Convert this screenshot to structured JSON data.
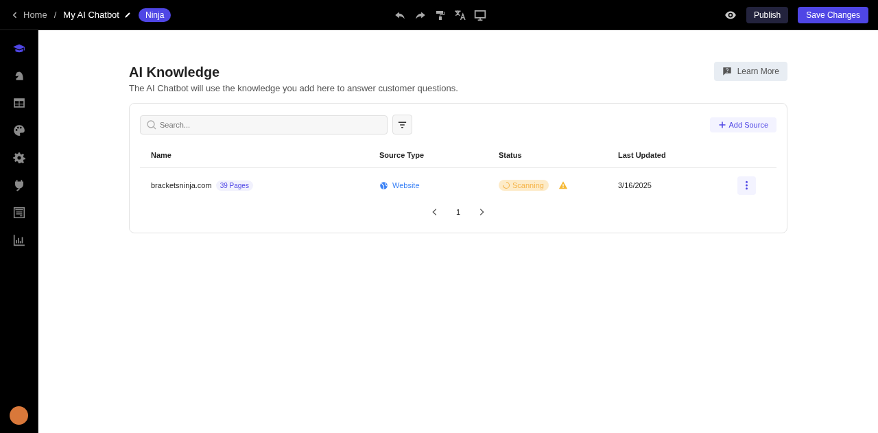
{
  "topbar": {
    "back": "Home",
    "separator": "/",
    "title": "My AI Chatbot",
    "badge": "Ninja",
    "publish": "Publish",
    "save": "Save Changes"
  },
  "sidebar": {
    "items": [
      {
        "selected": true
      },
      {
        "selected": false
      },
      {
        "selected": false
      },
      {
        "selected": false
      },
      {
        "selected": false
      },
      {
        "selected": false
      },
      {
        "selected": false
      },
      {
        "selected": false
      }
    ]
  },
  "page": {
    "title": "AI Knowledge",
    "subtitle": "The AI Chatbot will use the knowledge you add here to answer customer questions.",
    "learn_more": "Learn More"
  },
  "search": {
    "placeholder": "Search..."
  },
  "add_source": "Add Source",
  "table": {
    "columns": [
      "Name",
      "Source Type",
      "Status",
      "Last Updated"
    ],
    "rows": [
      {
        "name": "bracketsninja.com",
        "pages": "39 Pages",
        "source_type": "Website",
        "status": "Scanning",
        "warning": true,
        "last_updated": "3/16/2025"
      }
    ]
  },
  "pagination": {
    "pages": [
      {
        "label": "1",
        "selected": true
      }
    ]
  }
}
